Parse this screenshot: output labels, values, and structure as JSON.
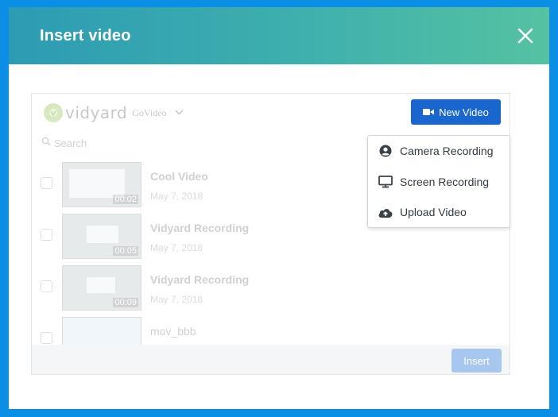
{
  "modal": {
    "title": "Insert video"
  },
  "header_actions": {
    "close_icon": "close-icon"
  },
  "library": {
    "brand": "vidyard",
    "workspace": "GoVideo",
    "search_placeholder": "Search",
    "new_video_label": "New Video",
    "insert_label": "Insert",
    "videos": [
      {
        "title": "Cool Video",
        "date": "May 7, 2018",
        "duration": "00:02"
      },
      {
        "title": "Vidyard Recording",
        "date": "May 7, 2018",
        "duration": "00:05"
      },
      {
        "title": "Vidyard Recording",
        "date": "May 7, 2018",
        "duration": "00:09"
      },
      {
        "title": "mov_bbb",
        "date": "",
        "duration": ""
      }
    ]
  },
  "new_video_menu": {
    "items": [
      {
        "label": "Camera Recording",
        "icon": "user-circle-icon"
      },
      {
        "label": "Screen Recording",
        "icon": "monitor-icon"
      },
      {
        "label": "Upload Video",
        "icon": "cloud-upload-icon"
      }
    ]
  },
  "colors": {
    "background": "#0b8fe6",
    "header_gradient_start": "#2d9bb3",
    "header_gradient_end": "#55c2a2",
    "primary_button": "#1a66cf",
    "disabled_button": "#a8c7ee"
  }
}
